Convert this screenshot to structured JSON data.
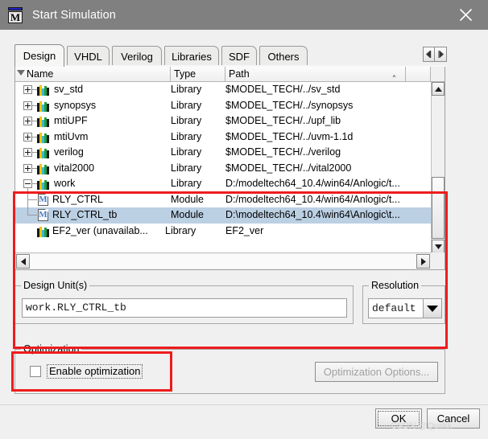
{
  "window": {
    "title": "Start Simulation",
    "icon": "modelsim-m-icon",
    "close_label": "✕"
  },
  "tabs": [
    {
      "label": "Design",
      "active": true
    },
    {
      "label": "VHDL",
      "active": false
    },
    {
      "label": "Verilog",
      "active": false
    },
    {
      "label": "Libraries",
      "active": false
    },
    {
      "label": "SDF",
      "active": false
    },
    {
      "label": "Others",
      "active": false
    }
  ],
  "tab_nav": {
    "prev": "◄",
    "next": "►"
  },
  "tree": {
    "columns": [
      {
        "key": "name",
        "label": "Name",
        "sort": "desc"
      },
      {
        "key": "type",
        "label": "Type",
        "sort": "none"
      },
      {
        "key": "path",
        "label": "Path",
        "sort": "asc"
      }
    ],
    "rows": [
      {
        "name": "sv_std",
        "type": "Library",
        "path": "$MODEL_TECH/../sv_std",
        "icon": "library-icon",
        "depth": 0,
        "expander": "plus",
        "selected": false
      },
      {
        "name": "synopsys",
        "type": "Library",
        "path": "$MODEL_TECH/../synopsys",
        "icon": "library-icon",
        "depth": 0,
        "expander": "plus",
        "selected": false
      },
      {
        "name": "mtiUPF",
        "type": "Library",
        "path": "$MODEL_TECH/../upf_lib",
        "icon": "library-icon",
        "depth": 0,
        "expander": "plus",
        "selected": false
      },
      {
        "name": "mtiUvm",
        "type": "Library",
        "path": "$MODEL_TECH/../uvm-1.1d",
        "icon": "library-icon",
        "depth": 0,
        "expander": "plus",
        "selected": false
      },
      {
        "name": "verilog",
        "type": "Library",
        "path": "$MODEL_TECH/../verilog",
        "icon": "library-icon",
        "depth": 0,
        "expander": "plus",
        "selected": false
      },
      {
        "name": "vital2000",
        "type": "Library",
        "path": "$MODEL_TECH/../vital2000",
        "icon": "library-icon",
        "depth": 0,
        "expander": "plus",
        "selected": false
      },
      {
        "name": "work",
        "type": "Library",
        "path": "D:/modeltech64_10.4/win64/Anlogic/t...",
        "icon": "library-icon",
        "depth": 0,
        "expander": "minus",
        "selected": false
      },
      {
        "name": "RLY_CTRL",
        "type": "Module",
        "path": "D:/modeltech64_10.4/win64/Anlogic/t...",
        "icon": "module-icon",
        "depth": 1,
        "expander": "none",
        "selected": false
      },
      {
        "name": "RLY_CTRL_tb",
        "type": "Module",
        "path": "D:\\modeltech64_10.4\\win64\\Anlogic\\t...",
        "icon": "module-icon",
        "depth": 1,
        "expander": "none",
        "selected": true
      },
      {
        "name": "EF2_ver  (unavailab...",
        "type": "Library",
        "path": "EF2_ver",
        "icon": "library-icon",
        "depth": 0,
        "expander": "none",
        "selected": false
      }
    ]
  },
  "design_units": {
    "legend": "Design Unit(s)",
    "value": "work.RLY_CTRL_tb"
  },
  "resolution": {
    "legend": "Resolution",
    "value": "default"
  },
  "optimization": {
    "legend": "Optimization",
    "enable_label": "Enable optimization",
    "enable_checked": false,
    "options_button": "Optimization Options...",
    "options_disabled": true
  },
  "footer": {
    "ok_label": "OK",
    "cancel_label": "Cancel",
    "watermark": "CSDN @Quiikk"
  },
  "colors": {
    "titlebar": "#808080",
    "dialog": "#f0f0f0",
    "selection": "#bcd0e4",
    "annotation": "#ee1c1c"
  }
}
